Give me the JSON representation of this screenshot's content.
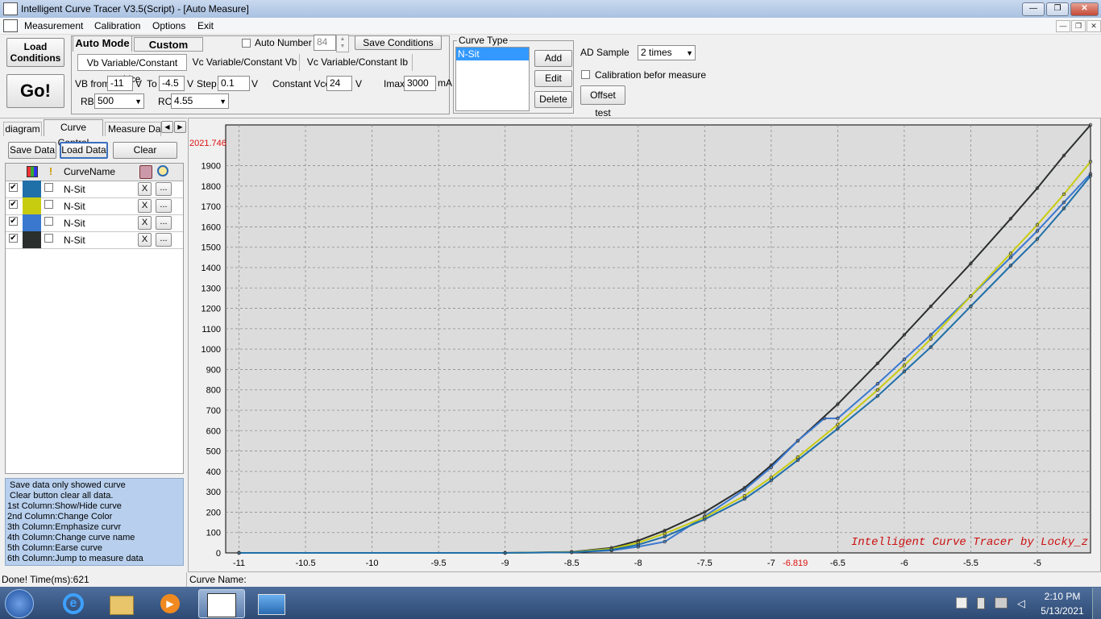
{
  "window": {
    "title": "Intelligent Curve Tracer V3.5(Script) - [Auto Measure]"
  },
  "menu": [
    "Measurement",
    "Calibration",
    "Options",
    "Exit"
  ],
  "toolbar": {
    "load_conditions": "Load\nConditions",
    "go": "Go!",
    "auto_mode": "Auto Mode",
    "custom_mode": "Custom Mode",
    "auto_number_label": "Auto Number",
    "auto_number_value": "84",
    "save_conditions": "Save Conditions",
    "mode_tabs": [
      "Vb Variable/Constant Vce",
      "Vc Variable/Constant Vb",
      "Vc Variable/Constant Ib"
    ],
    "vb_from_label": "VB from",
    "vb_from": "-11",
    "to_label": "To",
    "to_value": "-4.5",
    "step_label": "Step",
    "step_value": "0.1",
    "unit_v": "V",
    "constant_vce_label": "Constant Vce",
    "constant_vce": "24",
    "imax_label": "Imax",
    "imax": "3000",
    "unit_ma": "mA",
    "rb_label": "RB",
    "rb": "500",
    "rc_label": "RC",
    "rc": "4.55"
  },
  "curve_type": {
    "title": "Curve Type",
    "items": [
      "N-Sit"
    ],
    "add": "Add",
    "edit": "Edit",
    "delete": "Delete"
  },
  "ad": {
    "label": "AD Sample",
    "value": "2 times",
    "calibration": "Calibration befor measure",
    "offset_test": "Offset test"
  },
  "left_tabs": [
    "diagram",
    "Curve Control",
    "Measure Data"
  ],
  "curve_control": {
    "save": "Save Data",
    "load": "Load Data",
    "clear": "Clear",
    "header_name": "CurveName",
    "rows": [
      {
        "name": "N-Sit",
        "color": "#1f6fa8",
        "x": "X",
        "more": "..."
      },
      {
        "name": "N-Sit",
        "color": "#c8cc10",
        "x": "X",
        "more": "..."
      },
      {
        "name": "N-Sit",
        "color": "#3a78d0",
        "x": "X",
        "more": "..."
      },
      {
        "name": "N-Sit",
        "color": "#2a2e2c",
        "x": "X",
        "more": "..."
      }
    ]
  },
  "info_lines": [
    " Save data only showed curve",
    " Clear button clear all data.",
    "1st Column:Show/Hide curve",
    "2nd Column:Change Color",
    "3th Column:Emphasize curvr",
    "4th Column:Change curve name",
    "5th Column:Earse curve",
    "6th Column:Jump to measure data"
  ],
  "status": {
    "left": "Done!  Time(ms):621",
    "curve_name": "Curve Name:"
  },
  "chart_data": {
    "type": "line",
    "watermark": "Intelligent Curve Tracer by Locky_z",
    "max_label": "2021.746",
    "cursor_label": "-6.819",
    "xlim": [
      -11.1,
      -4.6
    ],
    "ylim": [
      0,
      2100
    ],
    "x_ticks": [
      -11,
      -10.5,
      -10,
      -9.5,
      -9,
      -8.5,
      -8,
      -7.5,
      -7,
      -6.5,
      -6,
      -5.5,
      -5
    ],
    "y_ticks": [
      0,
      100,
      200,
      300,
      400,
      500,
      600,
      700,
      800,
      900,
      1000,
      1100,
      1200,
      1300,
      1400,
      1500,
      1600,
      1700,
      1800,
      1900
    ],
    "grid": true,
    "series": [
      {
        "color": "#2a2e2c",
        "x": [
          -11,
          -9,
          -8.5,
          -8.2,
          -8,
          -7.8,
          -7.5,
          -7.2,
          -7,
          -6.8,
          -6.5,
          -6.2,
          -6,
          -5.8,
          -5.5,
          -5.2,
          -5,
          -4.8,
          -4.6
        ],
        "y": [
          0,
          0,
          5,
          25,
          60,
          110,
          200,
          320,
          430,
          550,
          730,
          930,
          1070,
          1210,
          1420,
          1640,
          1790,
          1950,
          2100
        ]
      },
      {
        "color": "#3a78d0",
        "x": [
          -11,
          -9,
          -8.5,
          -8.2,
          -8,
          -7.8,
          -7.5,
          -7.2,
          -7,
          -6.8,
          -6.6,
          -6.5,
          -6.2,
          -6,
          -5.8,
          -5.5,
          -5.2,
          -5,
          -4.8,
          -4.6
        ],
        "y": [
          0,
          0,
          3,
          12,
          30,
          55,
          180,
          310,
          420,
          550,
          660,
          660,
          830,
          950,
          1070,
          1260,
          1450,
          1580,
          1720,
          1860
        ]
      },
      {
        "color": "#c8cc10",
        "x": [
          -11,
          -9,
          -8.5,
          -8.2,
          -8,
          -7.8,
          -7.5,
          -7.2,
          -7,
          -6.8,
          -6.5,
          -6.2,
          -6,
          -5.8,
          -5.5,
          -5.2,
          -5,
          -4.8,
          -4.6
        ],
        "y": [
          0,
          0,
          4,
          20,
          50,
          95,
          175,
          280,
          370,
          470,
          630,
          800,
          920,
          1050,
          1260,
          1470,
          1610,
          1760,
          1920
        ]
      },
      {
        "color": "#1f6fa8",
        "x": [
          -11,
          -9,
          -8.5,
          -8.2,
          -8,
          -7.8,
          -7.5,
          -7.2,
          -7,
          -6.8,
          -6.5,
          -6.2,
          -6,
          -5.8,
          -5.5,
          -5.2,
          -5,
          -4.8,
          -4.6
        ],
        "y": [
          0,
          0,
          3,
          15,
          40,
          80,
          165,
          265,
          355,
          455,
          610,
          770,
          890,
          1010,
          1210,
          1410,
          1540,
          1690,
          1850
        ]
      }
    ]
  },
  "clock": {
    "time": "2:10 PM",
    "date": "5/13/2021"
  },
  "colors": {
    "plot_bg": "#dcdcdc",
    "grid": "#8c8c8c",
    "watermark": "#cc1010",
    "info_bg": "#b8d0ee"
  }
}
